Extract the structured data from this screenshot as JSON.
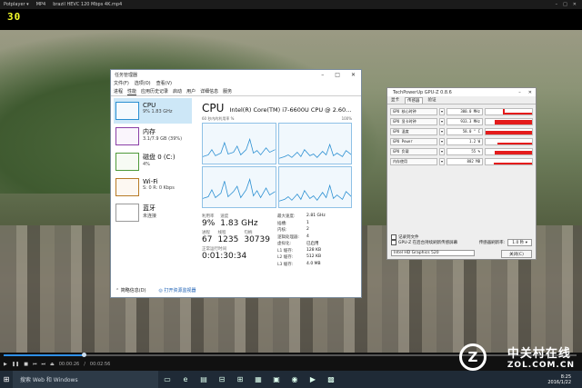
{
  "player": {
    "brand": "Potplayer ▾",
    "format": "MP4",
    "file": "brazil HEVC 120 Mbps 4K.mp4",
    "fps": "30",
    "time_current": "00:00:26",
    "time_total": "00:02:56",
    "progress_fraction": 0.14
  },
  "taskbar": {
    "search_placeholder": "搜索 Web 和 Windows",
    "time": "8:25",
    "date": "2016/1/22"
  },
  "watermark": {
    "title": "中关村在线",
    "sub": "ZOL.COM.CN",
    "logo_letter": "Z"
  },
  "taskmgr": {
    "title": "任务管理器",
    "menu": [
      "文件(F)",
      "选项(O)",
      "查看(V)"
    ],
    "tabs": [
      "进程",
      "性能",
      "应用历史记录",
      "启动",
      "用户",
      "详细信息",
      "服务"
    ],
    "active_tab": 1,
    "sidebar": [
      {
        "name": "CPU",
        "value": "9% 1.83 GHz"
      },
      {
        "name": "内存",
        "value": "3.1/7.9 GB (39%)"
      },
      {
        "name": "磁盘 0 (C:)",
        "value": "4%"
      },
      {
        "name": "Wi-Fi",
        "value": "S: 0 R: 0 Kbps"
      },
      {
        "name": "蓝牙",
        "value": "未连接"
      }
    ],
    "cpu_title": "CPU",
    "cpu_model": "Intel(R) Core(TM) i7-6600U CPU @ 2.60...",
    "graph_left_label": "60 秒内的利用率 %",
    "graph_right_label": "100%",
    "stats": {
      "util_label": "利用率",
      "util_value": "9%",
      "speed_label": "速度",
      "speed_value": "1.83 GHz",
      "proc_label": "进程",
      "proc_value": "67",
      "thread_label": "线程",
      "thread_value": "1235",
      "handle_label": "句柄",
      "handle_value": "30739",
      "uptime_label": "正常运行时间",
      "uptime_value": "0:01:30:34"
    },
    "specs": [
      {
        "k": "最大速度:",
        "v": "2.81 GHz"
      },
      {
        "k": "插槽:",
        "v": "1"
      },
      {
        "k": "内核:",
        "v": "2"
      },
      {
        "k": "逻辑处理器:",
        "v": "4"
      },
      {
        "k": "虚拟化:",
        "v": "已启用"
      },
      {
        "k": "L1 缓存:",
        "v": "128 KB"
      },
      {
        "k": "L2 缓存:",
        "v": "512 KB"
      },
      {
        "k": "L3 缓存:",
        "v": "4.0 MB"
      }
    ],
    "footer_brief": "简略信息(D)",
    "footer_link": "打开资源监视器"
  },
  "gpuz": {
    "title": "TechPowerUp GPU-Z 0.8.6",
    "tabs": [
      "显卡",
      "传感器",
      "验证"
    ],
    "active_tab": 1,
    "sensors": [
      {
        "name": "GPU 核心时钟",
        "value": "300.0 MHz"
      },
      {
        "name": "GPU 显卡时钟",
        "value": "933.3 MHz"
      },
      {
        "name": "GPU 温度",
        "value": "58.0 ° C"
      },
      {
        "name": "GPU Power",
        "value": "1.2 W"
      },
      {
        "name": "GPU 负载",
        "value": "55 %"
      },
      {
        "name": "内存使用",
        "value": "882 MB"
      }
    ],
    "log_label": "记录到文件",
    "cont_label": "GPU-Z 在后台持续刷新传感屏幕",
    "rate_label": "传感器刷新率:",
    "rate_value": "1.0 秒",
    "device": "Intel HD Graphics 520",
    "close_label": "关闭(C)"
  }
}
